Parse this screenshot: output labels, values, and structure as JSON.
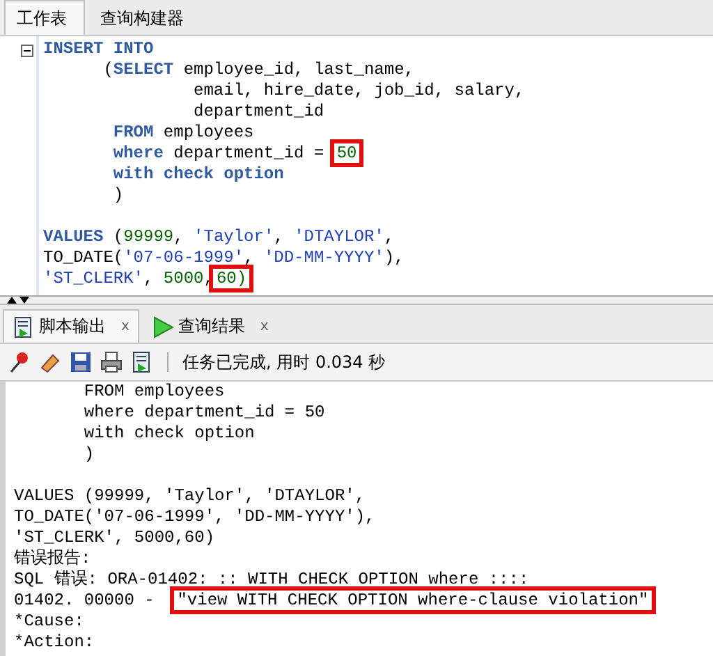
{
  "editor_tabs": [
    {
      "label": "工作表",
      "selected": true
    },
    {
      "label": "查询构建器",
      "selected": false
    }
  ],
  "editor": {
    "lines": [
      {
        "segments": [
          {
            "text": "INSERT INTO",
            "kind": "keyword"
          }
        ]
      },
      {
        "segments": [
          {
            "text": "      (",
            "kind": "plain"
          },
          {
            "text": "SELECT",
            "kind": "keyword"
          },
          {
            "text": " employee_id, last_name,",
            "kind": "plain"
          }
        ]
      },
      {
        "segments": [
          {
            "text": "               email, hire_date, job_id, salary,",
            "kind": "plain"
          }
        ]
      },
      {
        "segments": [
          {
            "text": "               department_id",
            "kind": "plain"
          }
        ]
      },
      {
        "segments": [
          {
            "text": "       FROM",
            "kind": "keyword"
          },
          {
            "text": " employees",
            "kind": "plain"
          }
        ]
      },
      {
        "segments": [
          {
            "text": "       where",
            "kind": "keyword"
          },
          {
            "text": " department_id = ",
            "kind": "plain"
          },
          {
            "text": "50",
            "kind": "number",
            "marked": true
          }
        ]
      },
      {
        "segments": [
          {
            "text": "       with check option",
            "kind": "keyword"
          }
        ]
      },
      {
        "segments": [
          {
            "text": "       )",
            "kind": "plain"
          }
        ]
      },
      {
        "kind": "blank"
      },
      {
        "segments": [
          {
            "text": "VALUES",
            "kind": "keyword"
          },
          {
            "text": " (",
            "kind": "plain"
          },
          {
            "text": "99999",
            "kind": "number"
          },
          {
            "text": ", ",
            "kind": "plain"
          },
          {
            "text": "'Taylor'",
            "kind": "string"
          },
          {
            "text": ", ",
            "kind": "plain"
          },
          {
            "text": "'DTAYLOR'",
            "kind": "string"
          },
          {
            "text": ",",
            "kind": "plain"
          }
        ]
      },
      {
        "segments": [
          {
            "text": "TO_DATE(",
            "kind": "plain"
          },
          {
            "text": "'07-06-1999'",
            "kind": "string"
          },
          {
            "text": ", ",
            "kind": "plain"
          },
          {
            "text": "'DD-MM-YYYY'",
            "kind": "string"
          },
          {
            "text": "),",
            "kind": "plain"
          }
        ]
      },
      {
        "segments": [
          {
            "text": "'ST_CLERK'",
            "kind": "string"
          },
          {
            "text": ", ",
            "kind": "plain"
          },
          {
            "text": "5000",
            "kind": "number"
          },
          {
            "text": ",",
            "kind": "plain"
          },
          {
            "text": "60)",
            "kind": "number",
            "marked": true
          }
        ]
      }
    ]
  },
  "output_tabs": [
    {
      "label": "脚本输出",
      "kind": "script",
      "selected": true,
      "close": "x"
    },
    {
      "label": "查询结果",
      "kind": "play",
      "selected": false,
      "close": "x"
    }
  ],
  "toolbar": {
    "status": "任务已完成, 用时 0.034 秒"
  },
  "output": {
    "lines": [
      {
        "segments": [
          {
            "text": "       FROM employees"
          }
        ]
      },
      {
        "segments": [
          {
            "text": "       where department_id = 50"
          }
        ]
      },
      {
        "segments": [
          {
            "text": "       with check option"
          }
        ]
      },
      {
        "segments": [
          {
            "text": "       )"
          }
        ]
      },
      {
        "kind": "blank"
      },
      {
        "segments": [
          {
            "text": "VALUES (99999, 'Taylor', 'DTAYLOR',"
          }
        ]
      },
      {
        "segments": [
          {
            "text": "TO_DATE('07-06-1999', 'DD-MM-YYYY'),"
          }
        ]
      },
      {
        "segments": [
          {
            "text": "'ST_CLERK', 5000,60)"
          }
        ]
      },
      {
        "segments": [
          {
            "text": "错误报告:"
          }
        ]
      },
      {
        "segments": [
          {
            "text": "SQL 错误: ORA-01402: :: WITH CHECK OPTION where ::::"
          }
        ]
      },
      {
        "segments": [
          {
            "text": "01402. 00000 -  "
          },
          {
            "text": "\"view WITH CHECK OPTION where-clause violation\"",
            "marked": true
          }
        ]
      },
      {
        "segments": [
          {
            "text": "*Cause:"
          }
        ]
      },
      {
        "segments": [
          {
            "text": "*Action:"
          }
        ]
      }
    ]
  }
}
